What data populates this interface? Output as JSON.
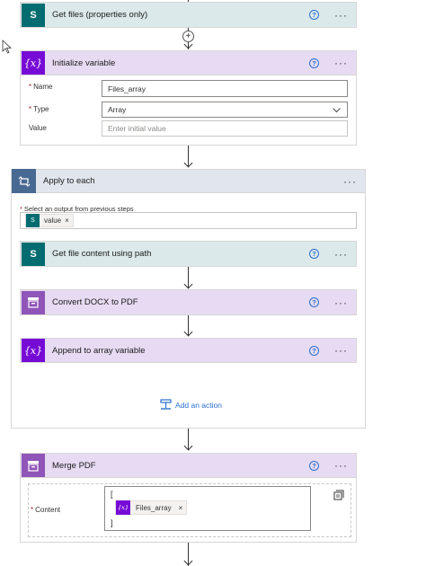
{
  "actions": {
    "get_files": {
      "title": "Get files (properties only)"
    },
    "initialize_variable": {
      "title": "Initialize variable",
      "name_label": "Name",
      "name_value": "Files_array",
      "type_label": "Type",
      "type_value": "Array",
      "value_label": "Value",
      "value_placeholder": "Enter initial value"
    },
    "apply_to_each": {
      "title": "Apply to each",
      "select_label": "Select an output from previous steps",
      "token_label": "value",
      "add_action_label": "Add an action"
    },
    "get_file_content": {
      "title": "Get file content using path"
    },
    "convert_docx": {
      "title": "Convert DOCX to PDF"
    },
    "append_array": {
      "title": "Append to array variable"
    },
    "merge_pdf": {
      "title": "Merge PDF",
      "content_label": "Content",
      "open_bracket": "[",
      "close_bracket": "]",
      "token_label": "Files_array"
    }
  },
  "symbols": {
    "help": "?",
    "more": "···",
    "remove": "×",
    "plus": "+",
    "variable_icon": "{x}",
    "variable_token_icon": "{x}",
    "sharepoint_letter": "S"
  },
  "colors": {
    "sharepoint": "#036c70",
    "variable": "#770bd6",
    "loop": "#486991",
    "pdf": "#8f55b8",
    "link": "#2b6fd0"
  }
}
